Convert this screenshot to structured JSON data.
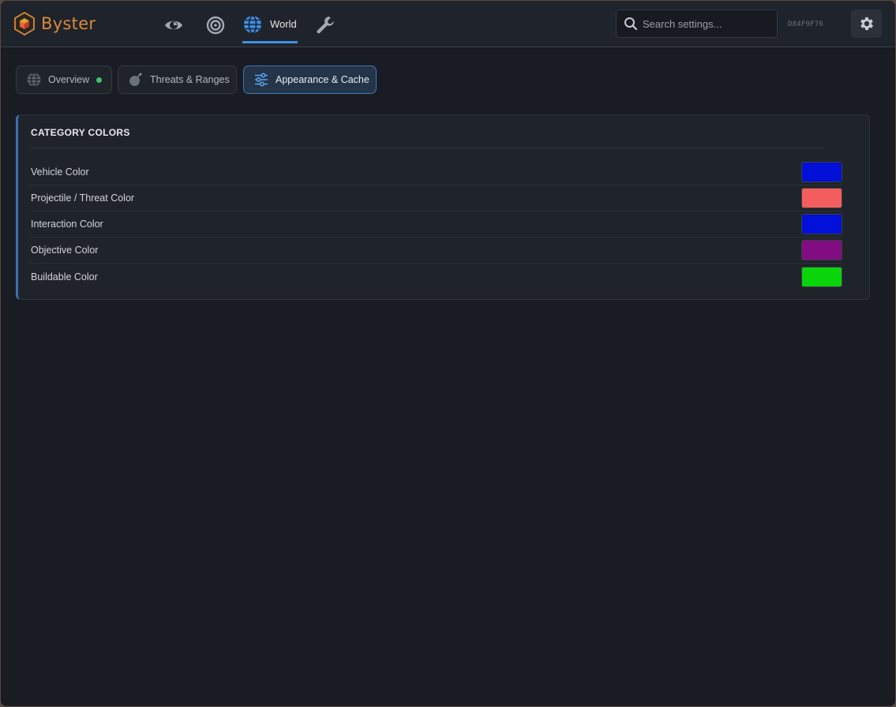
{
  "app": {
    "name": "Byster"
  },
  "nav": {
    "items": [
      {
        "icon": "eye-icon"
      },
      {
        "icon": "target-icon"
      },
      {
        "icon": "globe-icon",
        "label": "World",
        "active": true
      },
      {
        "icon": "wrench-icon"
      }
    ]
  },
  "search": {
    "placeholder": "Search settings...",
    "value": ""
  },
  "hwid": "D84F9F76",
  "tabs": [
    {
      "label": "Overview",
      "icon": "globe-icon",
      "status": "active-dot"
    },
    {
      "label": "Threats & Ranges",
      "icon": "bomb-icon"
    },
    {
      "label": "Appearance & Cache",
      "icon": "sliders-icon",
      "selected": true
    }
  ],
  "section": {
    "title": "CATEGORY COLORS",
    "rows": [
      {
        "label": "Vehicle Color",
        "color": "#0010d8"
      },
      {
        "label": "Projectile / Threat Color",
        "color": "#f45d5d"
      },
      {
        "label": "Interaction Color",
        "color": "#0010d8"
      },
      {
        "label": "Objective Color",
        "color": "#820c82"
      },
      {
        "label": "Buildable Color",
        "color": "#0ad40a"
      }
    ]
  },
  "colors": {
    "accent": "#3d8ee6",
    "brand": "#d98a3a",
    "status_ok": "#3fc46b"
  }
}
